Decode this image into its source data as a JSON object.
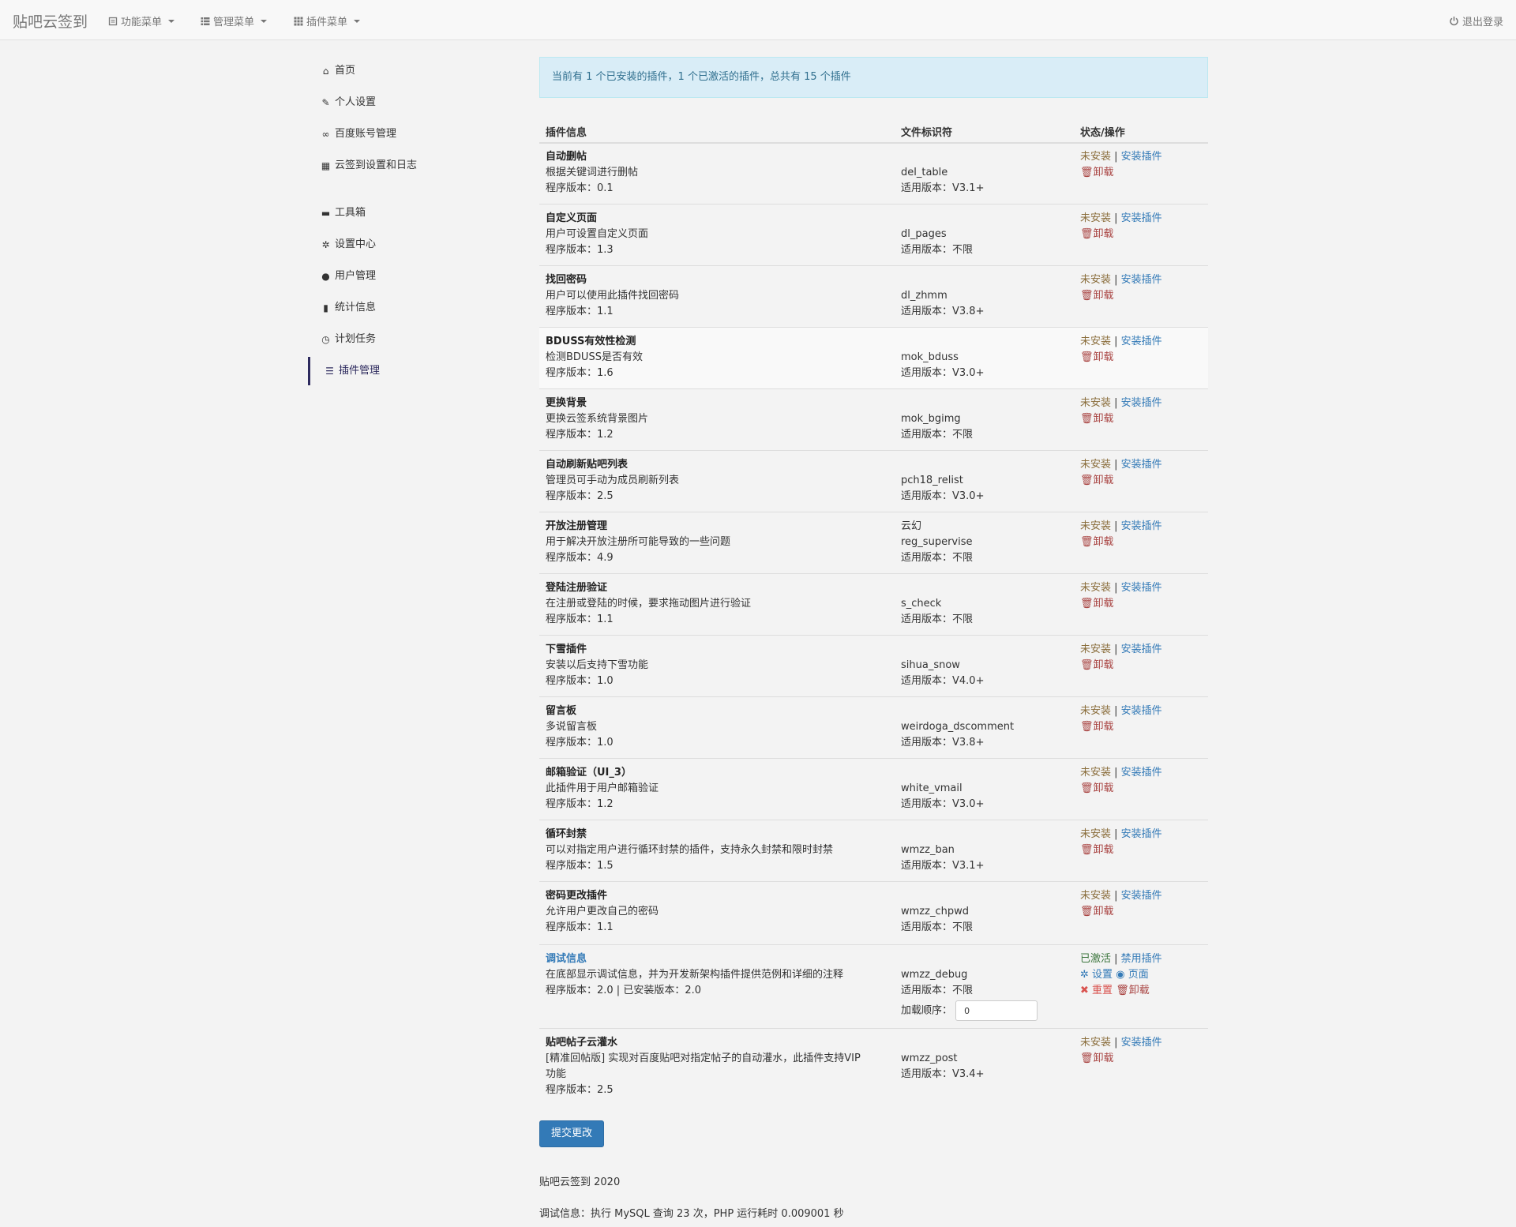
{
  "navbar": {
    "brand": "贴吧云签到",
    "menus": [
      "功能菜单",
      "管理菜单",
      "插件菜单"
    ],
    "logout": "退出登录"
  },
  "sidebar": {
    "items": [
      {
        "label": "首页",
        "icon": "home-icon"
      },
      {
        "label": "个人设置",
        "icon": "wrench-icon"
      },
      {
        "label": "百度账号管理",
        "icon": "link-icon"
      },
      {
        "label": "云签到设置和日志",
        "icon": "calendar-icon"
      },
      {
        "label": "工具箱",
        "icon": "briefcase-icon"
      },
      {
        "label": "设置中心",
        "icon": "gear-icon"
      },
      {
        "label": "用户管理",
        "icon": "user-icon"
      },
      {
        "label": "统计信息",
        "icon": "stats-icon"
      },
      {
        "label": "计划任务",
        "icon": "clock-icon"
      },
      {
        "label": "插件管理",
        "icon": "list-icon"
      }
    ],
    "active_index": 9
  },
  "alert": "当前有 1 个已安装的插件，1 个已激活的插件，总共有 15 个插件",
  "table": {
    "headers": [
      "插件信息",
      "文件标识符",
      "状态/操作"
    ],
    "rows": [
      {
        "name": "自动删帖",
        "desc": "根据关键词进行删帖",
        "ver": "程序版本：0.1",
        "author": "",
        "id": "del_table",
        "compat": "适用版本：V3.1+",
        "status": "未安装",
        "action": "安装插件",
        "uninstall": "卸载"
      },
      {
        "name": "自定义页面",
        "desc": "用户可设置自定义页面",
        "ver": "程序版本：1.3",
        "author": "",
        "id": "dl_pages",
        "compat": "适用版本：不限",
        "status": "未安装",
        "action": "安装插件",
        "uninstall": "卸载"
      },
      {
        "name": "找回密码",
        "desc": "用户可以使用此插件找回密码",
        "ver": "程序版本：1.1",
        "author": "",
        "id": "dl_zhmm",
        "compat": "适用版本：V3.8+",
        "status": "未安装",
        "action": "安装插件",
        "uninstall": "卸载"
      },
      {
        "name": "BDUSS有效性检测",
        "desc": "检测BDUSS是否有效",
        "ver": "程序版本：1.6",
        "author": "",
        "id": "mok_bduss",
        "compat": "适用版本：V3.0+",
        "status": "未安装",
        "action": "安装插件",
        "uninstall": "卸载"
      },
      {
        "name": "更换背景",
        "desc": "更换云签系统背景图片",
        "ver": "程序版本：1.2",
        "author": "",
        "id": "mok_bgimg",
        "compat": "适用版本：不限",
        "status": "未安装",
        "action": "安装插件",
        "uninstall": "卸载"
      },
      {
        "name": "自动刷新贴吧列表",
        "desc": "管理员可手动为成员刷新列表",
        "ver": "程序版本：2.5",
        "author": "",
        "id": "pch18_relist",
        "compat": "适用版本：V3.0+",
        "status": "未安装",
        "action": "安装插件",
        "uninstall": "卸载"
      },
      {
        "name": "开放注册管理",
        "desc": "用于解决开放注册所可能导致的一些问题",
        "ver": "程序版本：4.9",
        "author": "云幻",
        "id": "reg_supervise",
        "compat": "适用版本：不限",
        "status": "未安装",
        "action": "安装插件",
        "uninstall": "卸载"
      },
      {
        "name": "登陆注册验证",
        "desc": "在注册或登陆的时候，要求拖动图片进行验证",
        "ver": "程序版本：1.1",
        "author": "",
        "id": "s_check",
        "compat": "适用版本：不限",
        "status": "未安装",
        "action": "安装插件",
        "uninstall": "卸载"
      },
      {
        "name": "下雪插件",
        "desc": "安装以后支持下雪功能",
        "ver": "程序版本：1.0",
        "author": "",
        "id": "sihua_snow",
        "compat": "适用版本：V4.0+",
        "status": "未安装",
        "action": "安装插件",
        "uninstall": "卸载"
      },
      {
        "name": "留言板",
        "desc": "多说留言板",
        "ver": "程序版本：1.0",
        "author": "",
        "id": "weirdoga_dscomment",
        "compat": "适用版本：V3.8+",
        "status": "未安装",
        "action": "安装插件",
        "uninstall": "卸载"
      },
      {
        "name": "邮箱验证（UI_3）",
        "desc": "此插件用于用户邮箱验证",
        "ver": "程序版本：1.2",
        "author": "",
        "id": "white_vmail",
        "compat": "适用版本：V3.0+",
        "status": "未安装",
        "action": "安装插件",
        "uninstall": "卸载"
      },
      {
        "name": "循环封禁",
        "desc": "可以对指定用户进行循环封禁的插件，支持永久封禁和限时封禁",
        "ver": "程序版本：1.5",
        "author": "",
        "id": "wmzz_ban",
        "compat": "适用版本：V3.1+",
        "status": "未安装",
        "action": "安装插件",
        "uninstall": "卸载"
      },
      {
        "name": "密码更改插件",
        "desc": "允许用户更改自己的密码",
        "ver": "程序版本：1.1",
        "author": "",
        "id": "wmzz_chpwd",
        "compat": "适用版本：不限",
        "status": "未安装",
        "action": "安装插件",
        "uninstall": "卸载"
      }
    ],
    "debug_row": {
      "name": "调试信息",
      "desc": "在底部显示调试信息，并为开发新架构插件提供范例和详细的注释",
      "ver": "程序版本：2.0 | 已安装版本：2.0",
      "id": "wmzz_debug",
      "compat": "适用版本：不限",
      "order_label": "加载顺序：",
      "order_value": "0",
      "status": "已激活",
      "action": "禁用插件",
      "settings": "设置",
      "page": "页面",
      "reset": "重置",
      "uninstall": "卸载"
    },
    "last_row": {
      "name": "贴吧帖子云灌水",
      "desc1": "[精准回帖版] 实现对百度贴吧对指定帖子的自动灌水，此插件支持VIP",
      "desc2": "功能",
      "ver": "程序版本：2.5",
      "id": "wmzz_post",
      "compat": "适用版本：V3.4+",
      "status": "未安装",
      "action": "安装插件",
      "uninstall": "卸载"
    }
  },
  "submit": "提交更改",
  "footer": {
    "copyright": "贴吧云签到 2020",
    "debug": "调试信息：执行 MySQL 查询 23 次，PHP 运行耗时 0.009001 秒"
  },
  "colors": {
    "accent": "#337ab7",
    "active_sidebar": "#2d2a5e",
    "installed": "#3c763d",
    "not_installed": "#8a6d3b",
    "danger": "#a94442"
  }
}
